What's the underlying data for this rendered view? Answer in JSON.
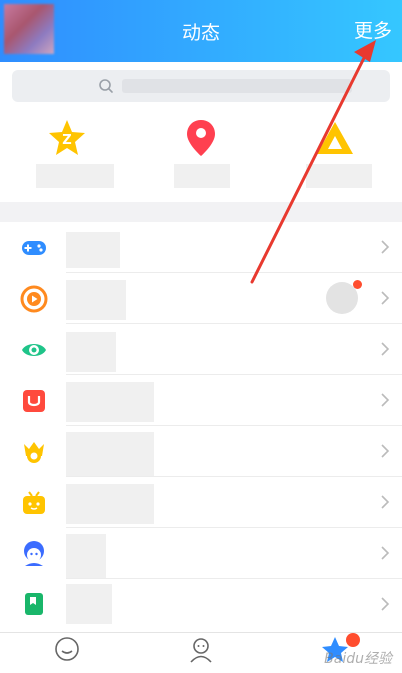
{
  "header": {
    "title": "动态",
    "more_label": "更多"
  },
  "search": {
    "placeholder": ""
  },
  "tiles": [
    {
      "label": "",
      "icon": "zone-icon",
      "color": "#ffc400"
    },
    {
      "label": "",
      "icon": "location-pin-icon",
      "color": "#ff4050"
    },
    {
      "label": "",
      "icon": "triangle-icon",
      "color": "#ffc400"
    }
  ],
  "list": [
    {
      "label": "",
      "icon": "gamepad-icon",
      "color": "#2f8dff"
    },
    {
      "label": "",
      "icon": "play-circle-icon",
      "color": "#ff8a1f"
    },
    {
      "label": "",
      "icon": "eye-icon",
      "color": "#1fc489"
    },
    {
      "label": "",
      "icon": "shopping-bag-icon",
      "color": "#ff4a3d"
    },
    {
      "label": "",
      "icon": "crown-badge-icon",
      "color": "#ffc400"
    },
    {
      "label": "",
      "icon": "tv-icon",
      "color": "#ffc400"
    },
    {
      "label": "",
      "icon": "cartoon-avatar-icon",
      "color": "#3b6cff"
    },
    {
      "label": "",
      "icon": "bookmark-icon",
      "color": "#19b66a"
    }
  ],
  "tabs": [
    {
      "label": "",
      "icon": "chat-bubble-icon"
    },
    {
      "label": "",
      "icon": "contacts-icon"
    },
    {
      "label": "",
      "icon": "star-icon",
      "badge": ""
    }
  ],
  "watermark": "Baidu经验",
  "colors": {
    "header_start": "#2f8dff",
    "header_end": "#35c7ff",
    "arrow": "#e8392f"
  }
}
